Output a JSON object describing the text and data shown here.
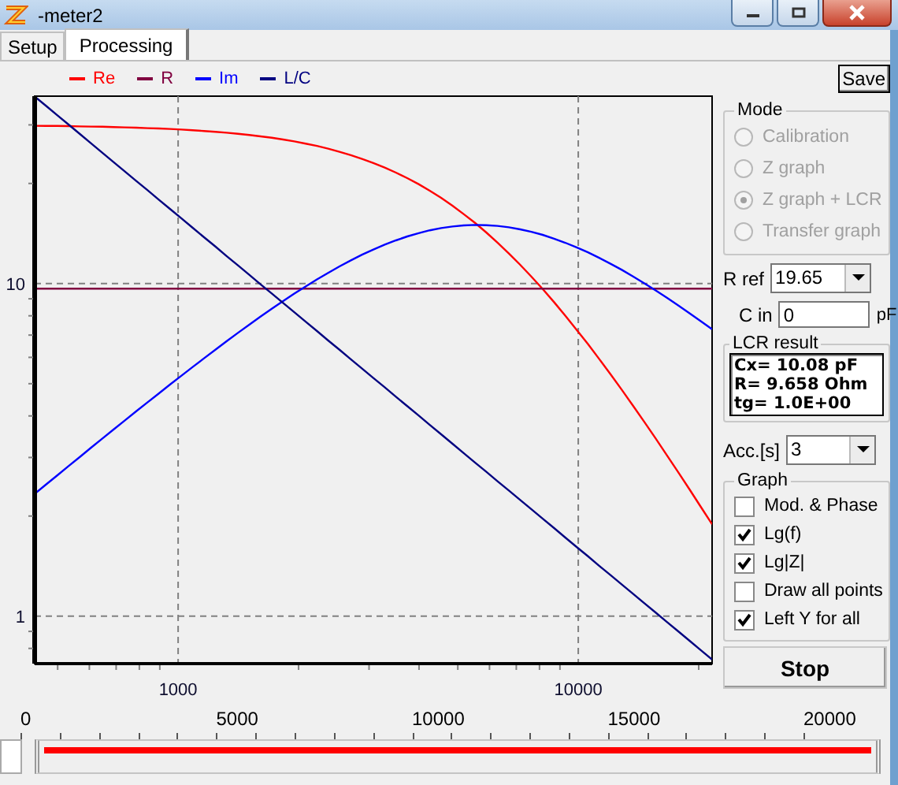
{
  "window": {
    "title": "-meter2"
  },
  "tabs": [
    {
      "label": "Setup",
      "selected": false
    },
    {
      "label": "Processing",
      "selected": true
    }
  ],
  "legend": [
    {
      "label": "Re",
      "color": "#ff0000"
    },
    {
      "label": "R",
      "color": "#800040"
    },
    {
      "label": "Im",
      "color": "#0000ff"
    },
    {
      "label": "L/C",
      "color": "#000080"
    }
  ],
  "plot": {
    "x_tick_labels": [
      "1000",
      "10000"
    ],
    "y_tick_labels": [
      "10",
      "1"
    ]
  },
  "save_button": "Save",
  "mode": {
    "title": "Mode",
    "options": [
      {
        "label": "Calibration",
        "selected": false
      },
      {
        "label": "Z graph",
        "selected": false
      },
      {
        "label": "Z graph + LCR",
        "selected": true
      },
      {
        "label": "Transfer graph",
        "selected": false
      }
    ],
    "disabled": true
  },
  "r_ref": {
    "label": "R ref",
    "value": "19.65"
  },
  "c_in": {
    "label": "C in",
    "value": "0",
    "unit": "pF"
  },
  "lcr_result": {
    "title": "LCR result",
    "lines": [
      "Cx= 10.08 pF",
      "R= 9.658 Ohm",
      "tg= 1.0E+00"
    ]
  },
  "acc": {
    "label": "Acc.[s]",
    "value": "3"
  },
  "graph": {
    "title": "Graph",
    "options": [
      {
        "label": "Mod. & Phase",
        "checked": false
      },
      {
        "label": "Lg(f)",
        "checked": true
      },
      {
        "label": "Lg|Z|",
        "checked": true
      },
      {
        "label": "Draw all points",
        "checked": false
      },
      {
        "label": "Left Y for all",
        "checked": true
      }
    ]
  },
  "stop_button": "Stop",
  "ruler": [
    "0",
    "5000",
    "10000",
    "15000",
    "20000"
  ],
  "sweep_bar": {
    "level": 1
  }
}
